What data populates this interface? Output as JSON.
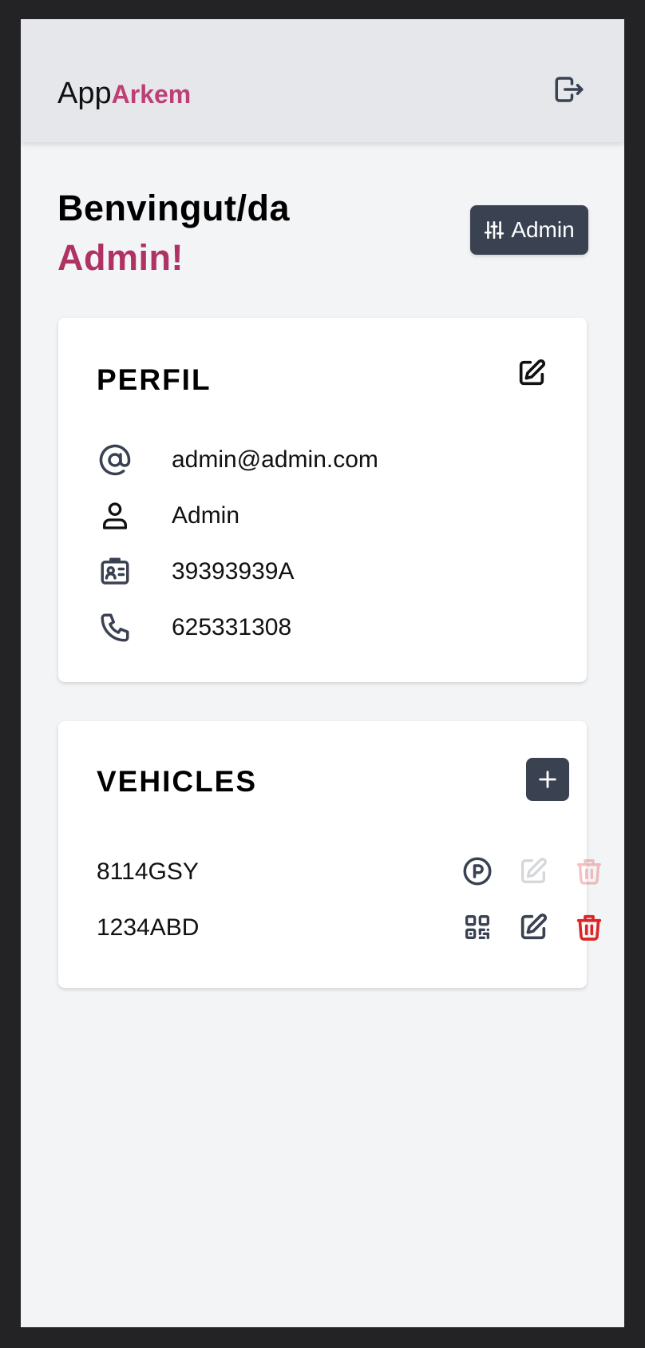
{
  "header": {
    "logo_part1": "App",
    "logo_part2": "Arkem",
    "logout_icon": "logout-icon"
  },
  "welcome": {
    "line1": "Benvingut/da",
    "line2": "Admin!"
  },
  "admin_button": {
    "label": "Admin",
    "icon": "sliders-icon"
  },
  "profile": {
    "title": "PERFIL",
    "edit_icon": "edit-icon",
    "items": [
      {
        "icon": "at-sign-icon",
        "value": "admin@admin.com"
      },
      {
        "icon": "user-icon",
        "value": "Admin"
      },
      {
        "icon": "id-card-icon",
        "value": "39393939A"
      },
      {
        "icon": "phone-icon",
        "value": "625331308"
      }
    ]
  },
  "vehicles": {
    "title": "VEHICLES",
    "add_icon": "plus-icon",
    "items": [
      {
        "plate": "8114GSY",
        "status_icon": "parking-icon",
        "actions_enabled": false
      },
      {
        "plate": "1234ABD",
        "status_icon": "qr-code-icon",
        "actions_enabled": true
      }
    ]
  },
  "colors": {
    "accent": "#be3f74",
    "dark_button": "#3a4252",
    "delete": "#dc2626",
    "header_bg": "#e5e7eb",
    "page_bg": "#f3f4f6"
  }
}
